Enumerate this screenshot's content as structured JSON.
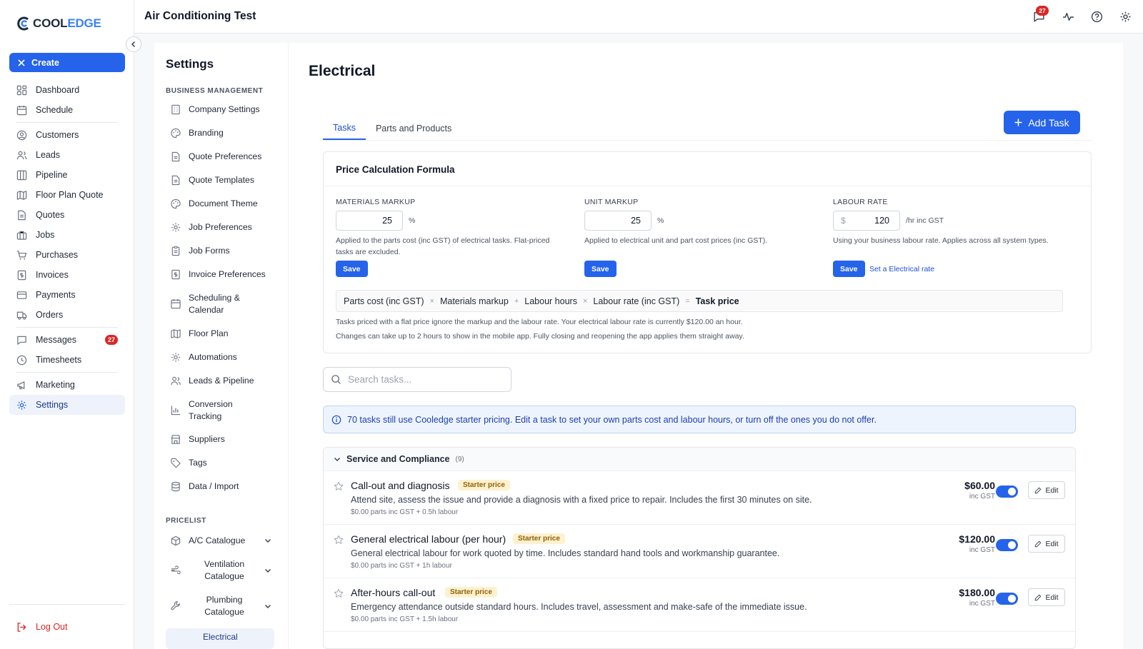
{
  "brand": {
    "logo_bold": "COOL",
    "logo_light": "EDGE"
  },
  "sidebar": {
    "create_label": "Create",
    "items": [
      {
        "label": "Dashboard",
        "icon": "dashboard-icon"
      },
      {
        "label": "Schedule",
        "icon": "calendar-icon"
      },
      {
        "label": "Customers",
        "icon": "user-circle-icon"
      },
      {
        "label": "Leads",
        "icon": "users-icon"
      },
      {
        "label": "Pipeline",
        "icon": "pipeline-icon"
      },
      {
        "label": "Floor Plan Quote",
        "icon": "floor-plan-icon"
      },
      {
        "label": "Quotes",
        "icon": "document-icon"
      },
      {
        "label": "Jobs",
        "icon": "briefcase-icon"
      },
      {
        "label": "Purchases",
        "icon": "cart-icon"
      },
      {
        "label": "Invoices",
        "icon": "invoice-icon"
      },
      {
        "label": "Payments",
        "icon": "credit-card-icon"
      },
      {
        "label": "Orders",
        "icon": "truck-icon"
      },
      {
        "label": "Messages",
        "icon": "message-icon",
        "badge": "27"
      },
      {
        "label": "Timesheets",
        "icon": "clock-icon"
      },
      {
        "label": "Marketing",
        "icon": "megaphone-icon"
      },
      {
        "label": "Settings",
        "icon": "gear-icon",
        "active": true
      }
    ],
    "logout_label": "Log Out"
  },
  "topbar": {
    "title": "Air Conditioning Test",
    "notification_count": "27"
  },
  "settings_nav": {
    "title": "Settings",
    "business_label": "BUSINESS MANAGEMENT",
    "business_items": [
      "Company Settings",
      "Branding",
      "Quote Preferences",
      "Quote Templates",
      "Document Theme",
      "Job Preferences",
      "Job Forms",
      "Invoice Preferences",
      "Scheduling & Calendar",
      "Floor Plan",
      "Automations",
      "Leads & Pipeline",
      "Conversion Tracking",
      "Suppliers",
      "Tags",
      "Data / Import"
    ],
    "pricelist_label": "PRICELIST",
    "pricelist_items": [
      "A/C Catalogue",
      "Ventilation Catalogue",
      "Plumbing Catalogue",
      "Electrical"
    ]
  },
  "page": {
    "title": "Electrical",
    "tabs": [
      "Tasks",
      "Parts and Products"
    ],
    "add_task_label": "Add Task",
    "formula_card": {
      "title": "Price Calculation Formula",
      "materials": {
        "label": "MATERIALS MARKUP",
        "value": "25",
        "unit": "%",
        "help": "Applied to the parts cost (inc GST) of electrical tasks. Flat-priced tasks are excluded.",
        "save": "Save"
      },
      "unit": {
        "label": "UNIT MARKUP",
        "value": "25",
        "unit": "%",
        "help": "Applied to electrical unit and part cost prices (inc GST).",
        "save": "Save"
      },
      "labour": {
        "label": "LABOUR RATE",
        "prefix": "$",
        "value": "120",
        "unit": "/hr inc GST",
        "help": "Using your business labour rate. Applies across all system types.",
        "save": "Save",
        "link": "Set a Electrical rate"
      },
      "formula": {
        "t1": "Parts cost (inc GST)",
        "op1": "×",
        "t2": "Materials markup",
        "op2": "+",
        "t3": "Labour hours",
        "op3": "×",
        "t4": "Labour rate (inc GST)",
        "op4": "=",
        "result": "Task price"
      },
      "note1": "Tasks priced with a flat price ignore the markup and the labour rate. Your electrical labour rate is currently $120.00 an hour.",
      "note2": "Changes can take up to 2 hours to show in the mobile app. Fully closing and reopening the app applies them straight away."
    },
    "search_placeholder": "Search tasks...",
    "info_banner": "70 tasks still use Cooledge starter pricing. Edit a task to set your own parts cost and labour hours, or turn off the ones you do not offer.",
    "group": {
      "name": "Service and Compliance",
      "count": "(9)"
    },
    "tasks": [
      {
        "name": "Call-out and diagnosis",
        "badge": "Starter price",
        "desc": "Attend site, assess the issue and provide a diagnosis with a fixed price to repair. Includes the first 30 minutes on site.",
        "meta": "$0.00 parts inc GST + 0.5h labour",
        "price": "$60.00",
        "gst": "inc GST",
        "edit": "Edit",
        "enabled": true
      },
      {
        "name": "General electrical labour (per hour)",
        "badge": "Starter price",
        "desc": "General electrical labour for work quoted by time. Includes standard hand tools and workmanship guarantee.",
        "meta": "$0.00 parts inc GST + 1h labour",
        "price": "$120.00",
        "gst": "inc GST",
        "edit": "Edit",
        "enabled": true
      },
      {
        "name": "After-hours call-out",
        "badge": "Starter price",
        "desc": "Emergency attendance outside standard hours. Includes travel, assessment and make-safe of the immediate issue.",
        "meta": "$0.00 parts inc GST + 1.5h labour",
        "price": "$180.00",
        "gst": "inc GST",
        "edit": "Edit",
        "enabled": true
      }
    ]
  },
  "colors": {
    "accent": "#2563eb",
    "badge_red": "#dc2626",
    "starter_badge_bg": "#fdf2cf"
  }
}
